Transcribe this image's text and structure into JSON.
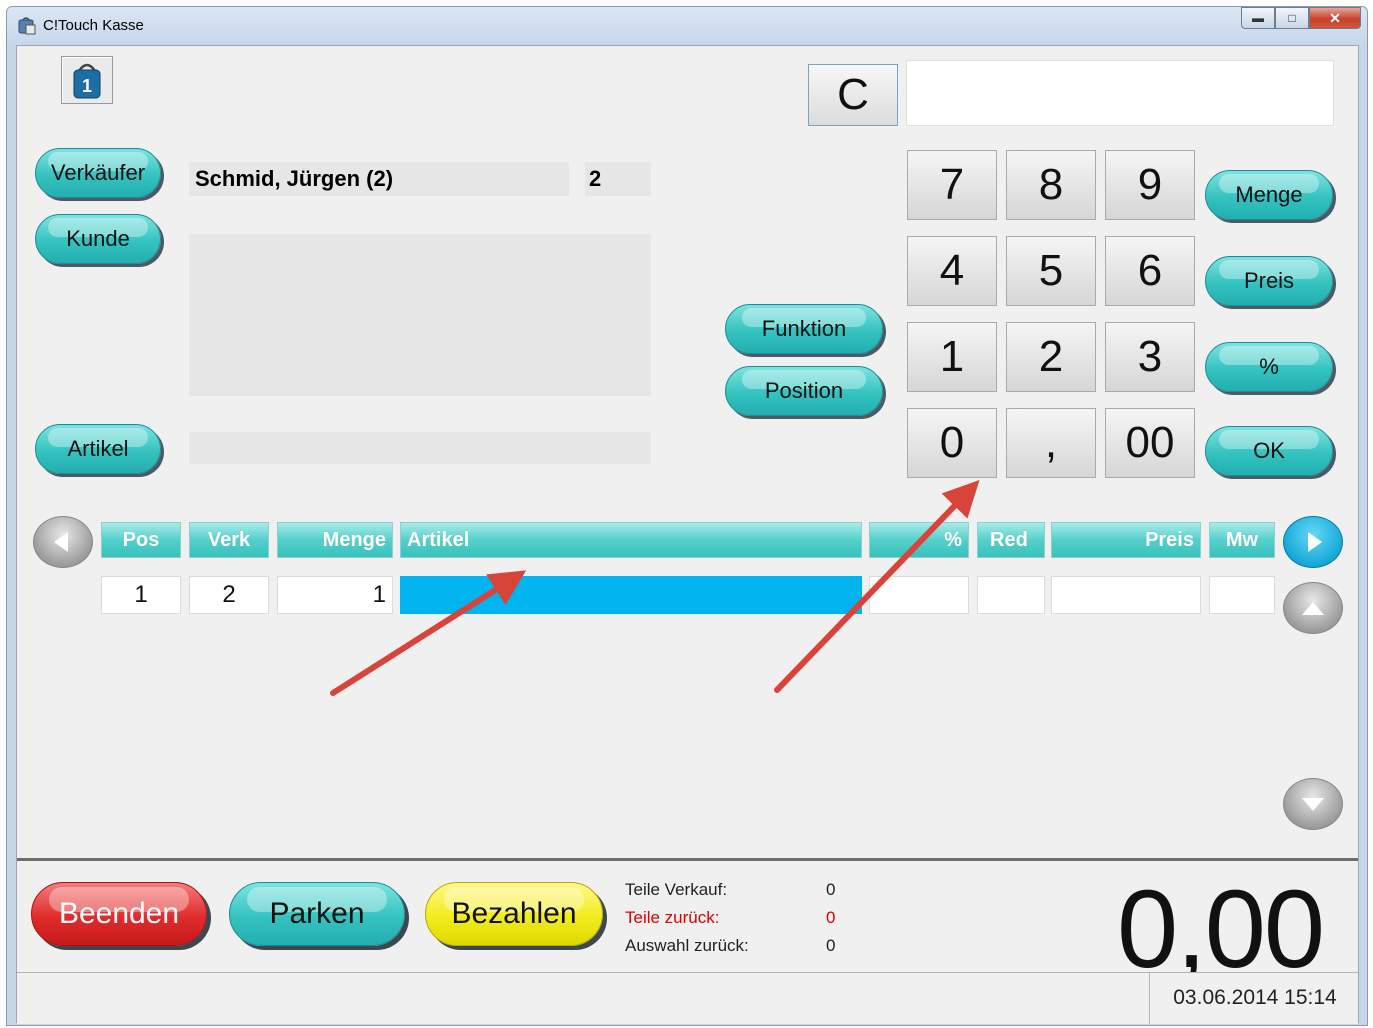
{
  "window": {
    "title": "C!Touch Kasse"
  },
  "colors": {
    "accent": "#34c3bf",
    "selection": "#00b4f0",
    "exit": "#e12b2b",
    "pay": "#f2ec1e",
    "warning_text": "#e00000"
  },
  "top": {
    "bag_badge": "1",
    "clear_label": "C",
    "display_value": ""
  },
  "left_buttons": {
    "seller": "Verkäufer",
    "customer": "Kunde",
    "article": "Artikel"
  },
  "seller_info": {
    "name": "Schmid, Jürgen (2)",
    "number": "2"
  },
  "function_buttons": {
    "function": "Funktion",
    "position": "Position"
  },
  "numpad": {
    "keys": [
      "7",
      "8",
      "9",
      "4",
      "5",
      "6",
      "1",
      "2",
      "3",
      "0",
      ",",
      "00"
    ]
  },
  "side_buttons": {
    "quantity": "Menge",
    "price": "Preis",
    "percent": "%",
    "ok": "OK"
  },
  "table": {
    "headers": {
      "pos": "Pos",
      "verk": "Verk",
      "menge": "Menge",
      "artikel": "Artikel",
      "percent": "%",
      "red": "Red",
      "preis": "Preis",
      "mw": "Mw"
    },
    "row": {
      "pos": "1",
      "verk": "2",
      "menge": "1",
      "artikel": "",
      "percent": "",
      "red": "",
      "preis": "",
      "mw": ""
    }
  },
  "bottom": {
    "exit": "Beenden",
    "park": "Parken",
    "pay": "Bezahlen",
    "stats": [
      {
        "label": "Teile Verkauf:",
        "value": "0"
      },
      {
        "label": "Teile zurück:",
        "value": "0"
      },
      {
        "label": "Auswahl zurück:",
        "value": "0"
      }
    ],
    "total": "0,00",
    "datetime": "03.06.2014 15:14"
  }
}
